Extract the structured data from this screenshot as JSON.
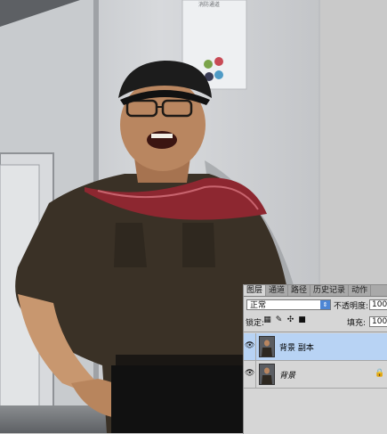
{
  "layers_panel": {
    "tabs": [
      {
        "label": "图层"
      },
      {
        "label": "通道"
      },
      {
        "label": "路径"
      },
      {
        "label": "历史记录"
      },
      {
        "label": "动作"
      }
    ],
    "blend_mode": "正常",
    "opacity_label": "不透明度:",
    "opacity_value": "100%",
    "lock_label": "锁定:",
    "fill_label": "填充:",
    "fill_value": "100%",
    "layers": [
      {
        "name": "背景 副本",
        "selected": true,
        "visible": true
      },
      {
        "name": "背景",
        "selected": false,
        "visible": true,
        "locked": true
      }
    ]
  },
  "photo": {
    "poster_text": "消防通道"
  },
  "colors": {
    "selection": "#b8d3f4",
    "panel_bg": "#d6d6d6",
    "tab_bar": "#a9a9a9"
  },
  "icons": [
    "eye-icon",
    "lock-icon",
    "move-icon",
    "brush-icon",
    "checkerboard-icon",
    "dropdown-arrow-icon"
  ]
}
